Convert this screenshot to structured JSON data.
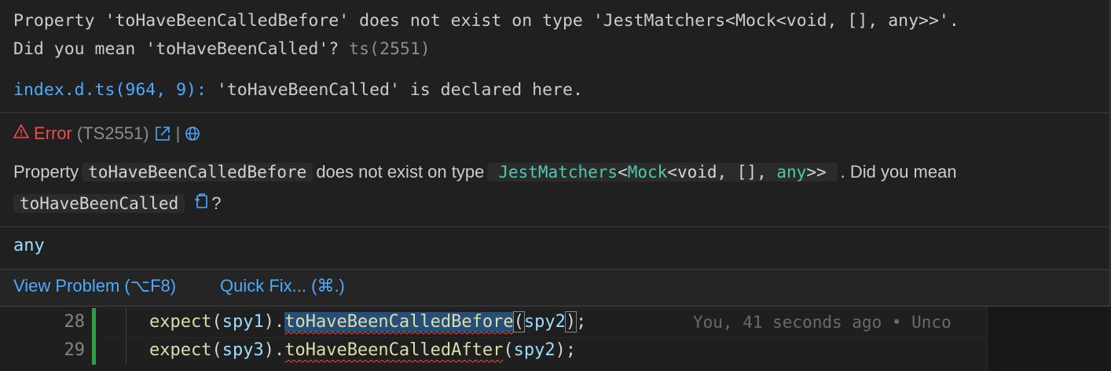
{
  "hover": {
    "ts_line1": "Property 'toHaveBeenCalledBefore' does not exist on type 'JestMatchers<Mock<void, [], any>>'.",
    "ts_line2_main": "Did you mean 'toHaveBeenCalled'?",
    "ts_line2_code": "ts(2551)",
    "decl_link": "index.d.ts(964, 9):",
    "decl_text": "'toHaveBeenCalled' is declared here.",
    "error_icon": "warning-triangle-icon",
    "error_label": "Error",
    "error_code": "(TS2551)",
    "pipe": "|",
    "msg_prefix": "Property",
    "msg_chip1": "toHaveBeenCalledBefore",
    "msg_mid": "does not exist on type",
    "msg_chip2": {
      "p1": "JestMatchers",
      "p2": "<",
      "p3": "Mock",
      "p4": "<void, [], ",
      "p5": "any",
      "p6": ">>"
    },
    "msg_tail": ". Did you mean",
    "msg_chip3": "toHaveBeenCalled",
    "msg_end": "?",
    "type_text": "any",
    "view_problem": "View Problem (⌥F8)",
    "quick_fix": "Quick Fix... (⌘.)"
  },
  "editor": {
    "lines": [
      {
        "number": "28",
        "fn": "expect",
        "open": "(",
        "arg1": "spy1",
        "mid": ").",
        "method": "toHaveBeenCalledBefore",
        "p_open": "(",
        "arg2": "spy2",
        "p_close": ")",
        "end": ";",
        "blame": "You, 41 seconds ago • Unco"
      },
      {
        "number": "29",
        "fn": "expect",
        "open": "(",
        "arg1": "spy3",
        "mid": ").",
        "method": "toHaveBeenCalledAfter",
        "p_open": "(",
        "arg2": "spy2",
        "p_close": ")",
        "end": ";"
      }
    ]
  },
  "colors": {
    "background": "#1f1f1f",
    "error": "#f14c4c",
    "link": "#4daafc",
    "type": "#4ec9b0"
  }
}
